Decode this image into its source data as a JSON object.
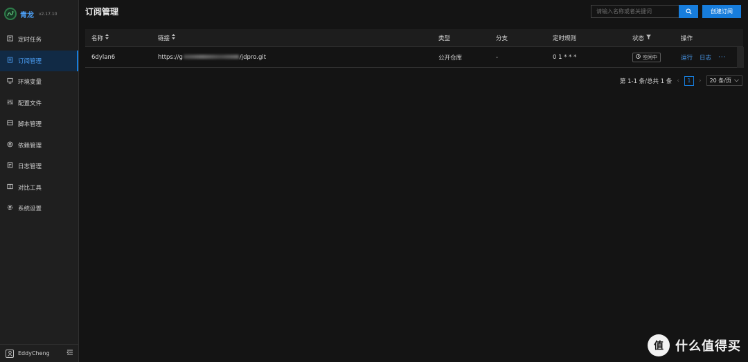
{
  "brand": {
    "name": "青龙",
    "version": "v2.17.10"
  },
  "sidebar": {
    "items": [
      {
        "label": "定时任务",
        "icon": "schedule-icon",
        "active": false
      },
      {
        "label": "订阅管理",
        "icon": "subscription-icon",
        "active": true
      },
      {
        "label": "环境变量",
        "icon": "desktop-icon",
        "active": false
      },
      {
        "label": "配置文件",
        "icon": "control-icon",
        "active": false
      },
      {
        "label": "脚本管理",
        "icon": "folder-icon",
        "active": false
      },
      {
        "label": "依赖管理",
        "icon": "dependency-icon",
        "active": false
      },
      {
        "label": "日志管理",
        "icon": "log-icon",
        "active": false
      },
      {
        "label": "对比工具",
        "icon": "diff-icon",
        "active": false
      },
      {
        "label": "系统设置",
        "icon": "setting-icon",
        "active": false
      }
    ]
  },
  "user": {
    "name": "EddyCheng"
  },
  "header": {
    "title": "订阅管理",
    "search_placeholder": "请输入名称或者关键词",
    "create_label": "创建订阅"
  },
  "table": {
    "columns": [
      "名称",
      "链接",
      "类型",
      "分支",
      "定时规则",
      "状态",
      "操作"
    ],
    "rows": [
      {
        "name": "6dylan6",
        "link_prefix": "https://g",
        "link_suffix": "/jdpro.git",
        "type": "公开仓库",
        "branch": "-",
        "schedule": "0 1 * * *",
        "status": "空闲中",
        "action_run": "运行",
        "action_log": "日志",
        "action_more": "···"
      }
    ]
  },
  "pagination": {
    "total_text": "第 1-1 条/总共 1 条",
    "current_page": "1",
    "page_size": "20 条/页"
  },
  "watermark": {
    "text": "什么值得买"
  },
  "colors": {
    "accent": "#177ddc",
    "link": "#4c9ff5",
    "bg": "#141414",
    "sidebar": "#1f1f1f"
  }
}
